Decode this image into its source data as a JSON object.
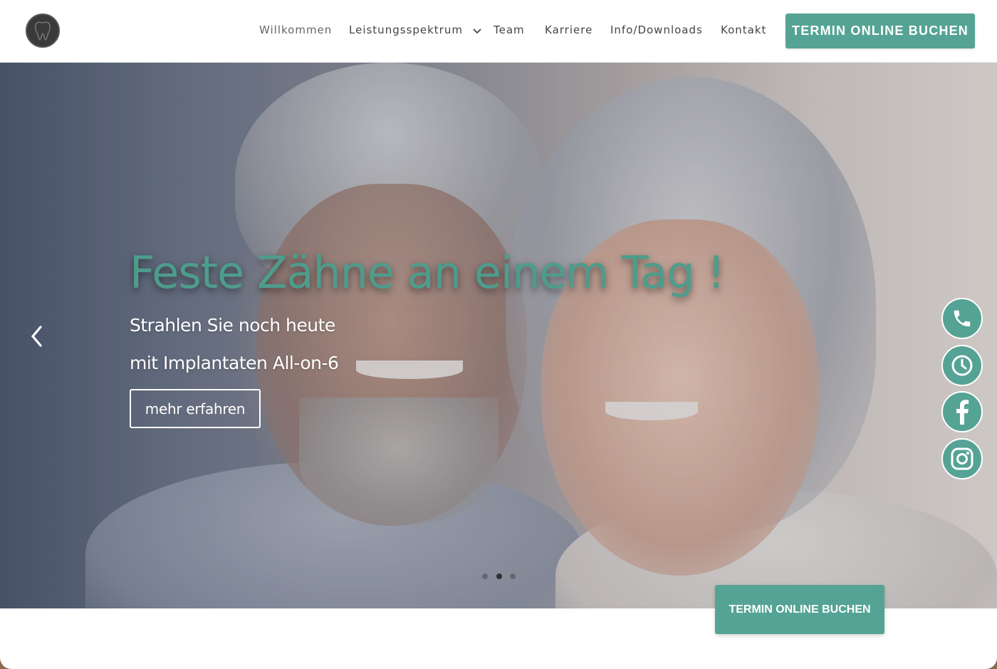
{
  "header": {
    "nav": [
      {
        "label": "Willkommen",
        "active": true
      },
      {
        "label": "Leistungsspektrum",
        "has_dropdown": true
      },
      {
        "label": "Team"
      },
      {
        "label": "Karriere"
      },
      {
        "label": "Info/Downloads"
      },
      {
        "label": "Kontakt"
      }
    ],
    "cta_label": "TERMIN ONLINE BUCHEN"
  },
  "hero": {
    "title": "Feste Zähne an einem Tag !",
    "subtitle_line1": "Strahlen Sie noch heute",
    "subtitle_line2": "mit Implantaten All-on-6",
    "button_label": "mehr erfahren",
    "slides_total": 3,
    "active_slide": 2
  },
  "side_links": [
    "phone-icon",
    "clock-icon",
    "facebook-icon",
    "instagram-icon"
  ],
  "floating_cta_label": "TERMIN ONLINE BUCHEN",
  "colors": {
    "accent": "#55a394",
    "title": "#4e9c8c",
    "nav_text": "#444444"
  }
}
